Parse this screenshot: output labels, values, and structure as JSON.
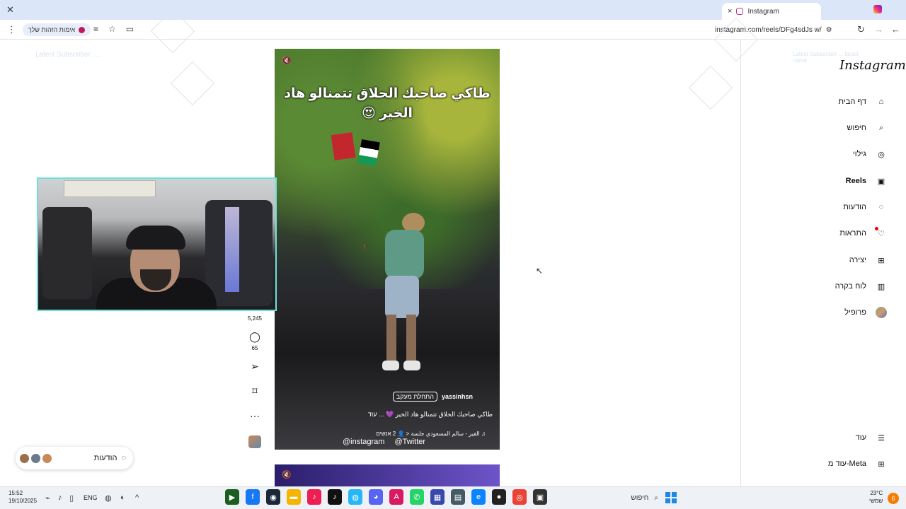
{
  "browser": {
    "tab_title": "Instagram",
    "tab_close": "×",
    "new_tab": "+",
    "close_window": "✕",
    "address": "instagram.com/reels/DFg4sdJs w/",
    "verify_chip": "אימות הזהות שלך",
    "menu": "⋮"
  },
  "sidebar": {
    "logo": "Instagram",
    "items": [
      {
        "label": "דף הבית",
        "icon": "home-icon",
        "glyph": "⌂"
      },
      {
        "label": "חיפוש",
        "icon": "search-icon",
        "glyph": "⌕"
      },
      {
        "label": "גילוי",
        "icon": "compass-icon",
        "glyph": "◎"
      },
      {
        "label": "Reels",
        "icon": "reels-icon",
        "glyph": "▣"
      },
      {
        "label": "הודעות",
        "icon": "messenger-icon",
        "glyph": "◌"
      },
      {
        "label": "התראות",
        "icon": "heart-icon",
        "glyph": "♡"
      },
      {
        "label": "יצירה",
        "icon": "create-icon",
        "glyph": "⊞"
      },
      {
        "label": "לוח בקרה",
        "icon": "dashboard-icon",
        "glyph": "▥"
      },
      {
        "label": "פרופיל",
        "icon": "profile-avatar",
        "glyph": ""
      }
    ],
    "more": {
      "label": "עוד",
      "glyph": "☰"
    },
    "meta": {
      "label": "עוד מ-Meta",
      "glyph": "⊞"
    }
  },
  "reel": {
    "caption": "طاكي صاحبك الحلاق تتمنالو هاد الخير 😍",
    "username": "yassinhsn",
    "follow": "התחלת מעקב",
    "description": "طاكي صاحبك الحلاق تتمنالو هاد الخير 💜 ... עוד",
    "audio": "♫ الفير - سالم المسعودي جلسة < 👤 2 אנשים",
    "overlay_instagram": "@instagram",
    "overlay_twitter": "@Twitter",
    "mute_icon": "🔇"
  },
  "actions": {
    "likes": "5,245",
    "comments": "65",
    "comment_glyph": "◯",
    "share_glyph": "➢",
    "save_glyph": "⌑",
    "more_glyph": "···"
  },
  "messages_pill": {
    "label": "הודעות"
  },
  "taskbar": {
    "time": "15:52",
    "date": "19/10/2025",
    "lang": "ENG",
    "search": "חיפוש",
    "weather_temp": "23°C",
    "weather_desc": "שמשי",
    "notif_count": "6"
  },
  "stream_overlay": {
    "line1": "Latest Subscriber: ...",
    "line2": "Latest Subscriber ... latest name"
  }
}
